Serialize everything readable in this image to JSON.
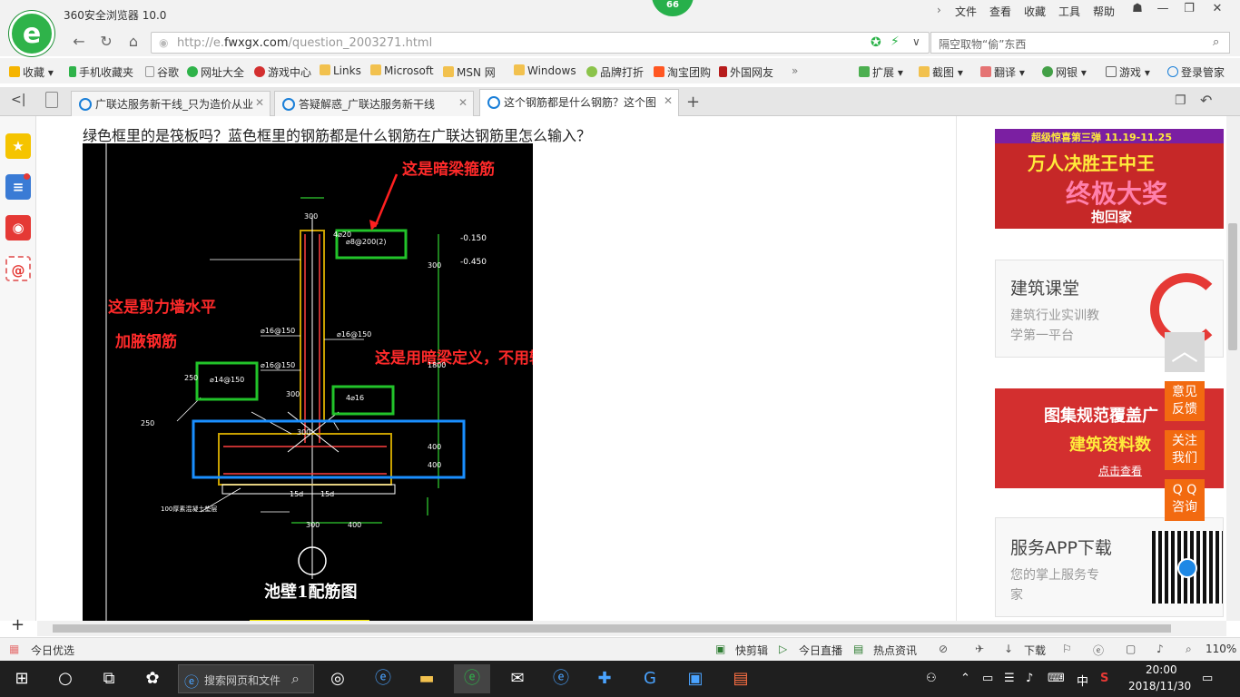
{
  "browser": {
    "title": "360安全浏览器 10.0",
    "badge": "66",
    "menu": [
      "文件",
      "查看",
      "收藏",
      "工具",
      "帮助"
    ],
    "url_prefix": "http://e.",
    "url_domain": "fwxgx.com",
    "url_path": "/question_2003271.html",
    "search_text": "隔空取物“偷”东西"
  },
  "bookmarks": [
    "收藏",
    "手机收藏夹",
    "谷歌",
    "网址大全",
    "游戏中心",
    "Links",
    "Microsoft",
    "MSN 网",
    "Windows",
    "品牌打折",
    "淘宝团购",
    "外国网友"
  ],
  "bookmarks_right": [
    "扩展",
    "截图",
    "翻译",
    "网银",
    "游戏",
    "登录管家"
  ],
  "tabs": [
    {
      "label": "广联达服务新干线_只为造价从业"
    },
    {
      "label": "答疑解惑_广联达服务新干线"
    },
    {
      "label": "这个钢筋都是什么钢筋？这个图"
    }
  ],
  "page": {
    "question": "绿色框里的是筏板吗？蓝色框里的钢筋都是什么钢筋在广联达钢筋里怎么输入？",
    "cad": {
      "note_stirrup": "这是暗梁箍筋",
      "note_haunch_1": "这是剪力墙水平",
      "note_haunch_2": "加腋钢筋",
      "note_define": "这是用暗梁定义，不用输入箍筋",
      "title": "池壁1配筋图",
      "dims": [
        "300",
        "-0.150",
        "-0.450",
        "300",
        "4⌀20",
        "⌀8@200(2)",
        "⌀16@150",
        "⌀16@150",
        "⌀16@150",
        "1800",
        "250",
        "⌀14@150",
        "300",
        "4⌀16",
        "250",
        "400",
        "300",
        "400",
        "15d",
        "15d",
        "300",
        "400",
        "100厚素混凝土垫层"
      ]
    }
  },
  "ads": {
    "promo_banner": {
      "line1": "超级惊喜第三弹  11.19-11.25",
      "line2": "万人决胜王中王",
      "line3": "终极大奖",
      "line4": "抱回家"
    },
    "course": {
      "title": "建筑课堂",
      "desc1": "建筑行业实训教",
      "desc2": "学第一平台"
    },
    "atlas": {
      "line1": "图集规范覆盖广",
      "line2": "建筑资料数",
      "link": "点击查看"
    },
    "app": {
      "title": "服务APP下载",
      "desc1": "您的掌上服务专",
      "desc2": "家"
    }
  },
  "float_buttons": {
    "feedback_1": "意见",
    "feedback_2": "反馈",
    "follow_1": "关注",
    "follow_2": "我们",
    "qq_1": "Q Q",
    "qq_2": "咨询"
  },
  "status": {
    "left": "今日优选",
    "items": [
      "快剪辑",
      "今日直播",
      "热点资讯",
      "下载"
    ],
    "zoom": "110%"
  },
  "taskbar": {
    "search_placeholder": "搜索网页和文件",
    "ime": "中",
    "time": "20:00",
    "date": "2018/11/30"
  }
}
